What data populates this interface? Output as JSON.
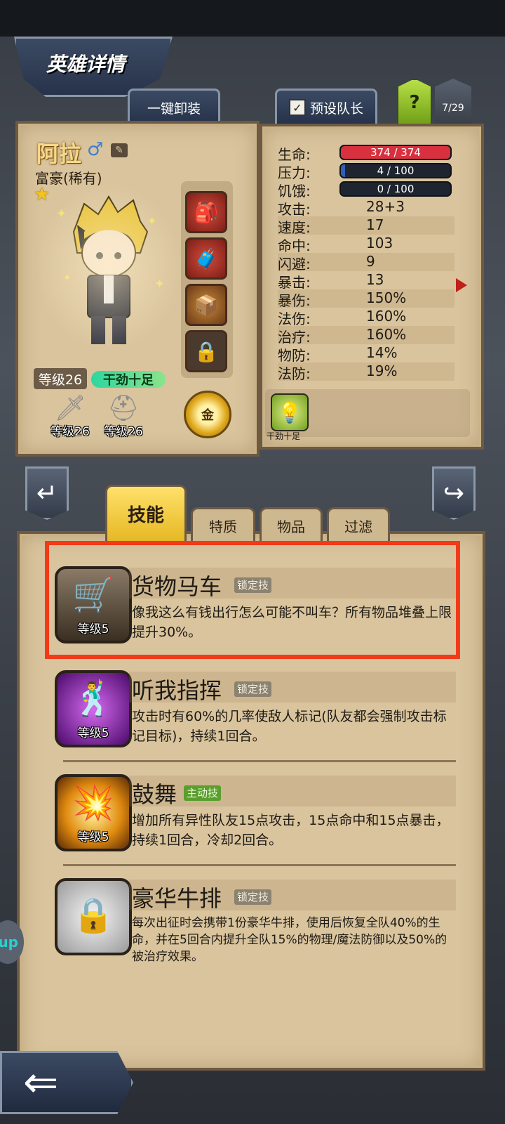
{
  "header": {
    "title": "英雄详情",
    "unequip_label": "一键卸装",
    "captain_label": "预设队长",
    "captain_check": "✓",
    "help_label": "?",
    "page_count": "7/29"
  },
  "hero": {
    "name": "阿拉",
    "gender_symbol": "♂",
    "class": "富豪(稀有)",
    "level": "等级26",
    "mood": "干劲十足",
    "weapon_level": "等级26",
    "helmet_level": "等级26",
    "gold_label": "金"
  },
  "stats": {
    "hp_label": "生命:",
    "hp_value": "374 / 374",
    "hp_fraction": 1.0,
    "stress_label": "压力:",
    "stress_value": "4 / 100",
    "stress_fraction": 0.04,
    "hunger_label": "饥饿:",
    "hunger_value": "0 / 100",
    "hunger_fraction": 0.0,
    "rows": [
      {
        "label": "攻击:",
        "value": "28+3"
      },
      {
        "label": "速度:",
        "value": "17"
      },
      {
        "label": "命中:",
        "value": "103"
      },
      {
        "label": "闪避:",
        "value": "9"
      },
      {
        "label": "暴击:",
        "value": "13"
      },
      {
        "label": "暴伤:",
        "value": "150%"
      },
      {
        "label": "法伤:",
        "value": "160%"
      },
      {
        "label": "治疗:",
        "value": "160%"
      },
      {
        "label": "物防:",
        "value": "14%"
      },
      {
        "label": "法防:",
        "value": "19%"
      }
    ],
    "trait_label": "干劲十足"
  },
  "tabs": {
    "skills": "技能",
    "traits": "特质",
    "items": "物品",
    "filter": "过滤"
  },
  "skills": [
    {
      "name": "货物马车",
      "tag": "锁定技",
      "level": "等级5",
      "desc": "像我这么有钱出行怎么可能不叫车？所有物品堆叠上限提升30%。"
    },
    {
      "name": "听我指挥",
      "tag": "锁定技",
      "level": "等级5",
      "desc": "攻击时有60%的几率使敌人标记(队友都会强制攻击标记目标)，持续1回合。"
    },
    {
      "name": "鼓舞",
      "tag": "主动技",
      "level": "等级5",
      "desc": "增加所有异性队友15点攻击，15点命中和15点暴击，持续1回合，冷却2回合。"
    },
    {
      "name": "豪华牛排",
      "tag": "锁定技",
      "level": "",
      "desc": "每次出征时会携带1份豪华牛排，使用后恢复全队40%的生命，并在5回合内提升全队15%的物理/魔法防御以及50%的被治疗效果。"
    }
  ],
  "colors": {
    "hp_bar": "#d8303e",
    "stress_bar": "#2f5fb8",
    "highlight": "#f23a18",
    "active_tag": "#5a9e2e"
  }
}
